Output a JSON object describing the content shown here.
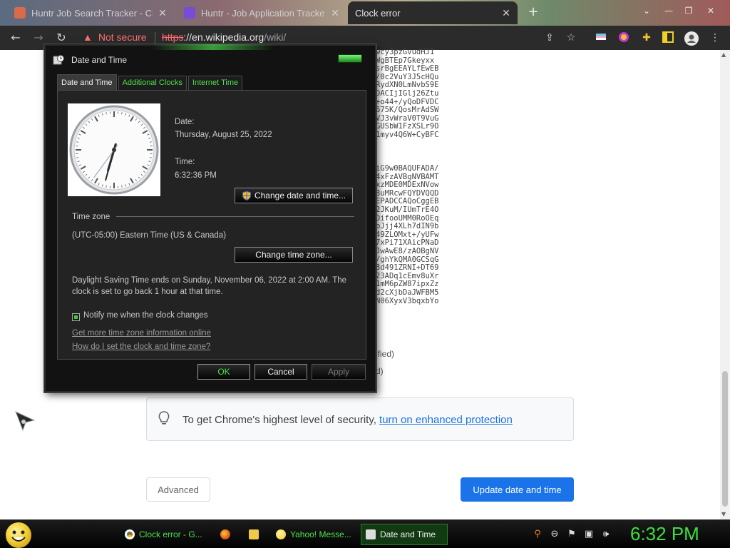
{
  "browser": {
    "tabs": [
      {
        "title": "Huntr Job Search Tracker - Chro",
        "active": false
      },
      {
        "title": "Huntr - Job Application Tracker",
        "active": false
      },
      {
        "title": "Clock error",
        "active": true
      }
    ],
    "security_label": "Not secure",
    "url_scheme": "https",
    "url_host": "://en.wikipedia.org",
    "url_path": "/wiki/",
    "new_tab": "+"
  },
  "page": {
    "cert_lines_a": "wcy3pzGvudHJ1\nWgBTEp7Gkeyxx\nsrBgEEAYLfEwEB\n/0c2VuY3J5cHQu\nRydXN0LmNvbS9E\nDACIjIGlj26Ztu\n+o44+/yQoDFVDC\n675K/QosMrAdSW\nVJ3vWraV0T9VuG\nGUSbW1FzXSLr9O\n1myv4Q6W+CyBFC",
    "cert_lines_b": "iG9w0BAQUFADA/\n4xFzAVBgNVBAMT\nxzMDE0MDExNVow\n3uMRcwFQYDVQQD\nEPADCCAQoCggEB\n2JKuM/IUmTrE4O\nDifooUMM0RoOEq\nbJjj4XLh7dIN9b\n49ZLOMxt+/yUFw\n7xPi71XAicPNaD\nJwAwE8/zAOBgNV\n/ghYkQMA0GCSqG\n3d491ZRNI+DT69\n23ADq1cEmv8uXr\n1mM6pZW87ipxZz\nd2cXjbDaJWFBM5\nN06XyxV3bqxbYo",
    "frag_1": "ified)",
    "frag_2": "d)",
    "enhanced_text": "To get Chrome's highest level of security, ",
    "enhanced_link": "turn on enhanced protection",
    "advanced_label": "Advanced",
    "update_label": "Update date and time"
  },
  "dialog": {
    "title": "Date and Time",
    "tabs": [
      "Date and Time",
      "Additional Clocks",
      "Internet Time"
    ],
    "date_label": "Date:",
    "date_value": "Thursday, August 25, 2022",
    "time_label": "Time:",
    "time_value": "6:32:36 PM",
    "change_date_button": "Change date and time...",
    "timezone_heading": "Time zone",
    "timezone_value": "(UTC-05:00) Eastern Time (US & Canada)",
    "change_timezone_button": "Change time zone...",
    "dst_line1": "Daylight Saving Time ends on Sunday, November 06, 2022 at 2:00 AM. The",
    "dst_line2": "clock is set to go back 1 hour at that time.",
    "notify_label": "Notify me when the clock changes",
    "link_more_info": "Get more time zone information online",
    "link_how_set": "How do I set the clock and time zone?",
    "ok_label": "OK",
    "cancel_label": "Cancel",
    "apply_label": "Apply",
    "clock_time": {
      "hour": 6,
      "minute": 32,
      "second": 36
    }
  },
  "taskbar": {
    "items": [
      {
        "label": "Clock error - G...",
        "active": false
      },
      {
        "label": "Yahoo! Messe...",
        "active": false
      },
      {
        "label": "Date and Time",
        "active": true
      }
    ],
    "clock": "6:32 PM"
  },
  "colors": {
    "chrome_dark": "#2b2b2b",
    "warning_red": "#ff6e6e",
    "link_blue": "#1a73e8",
    "theme_green": "#3ce03c"
  }
}
